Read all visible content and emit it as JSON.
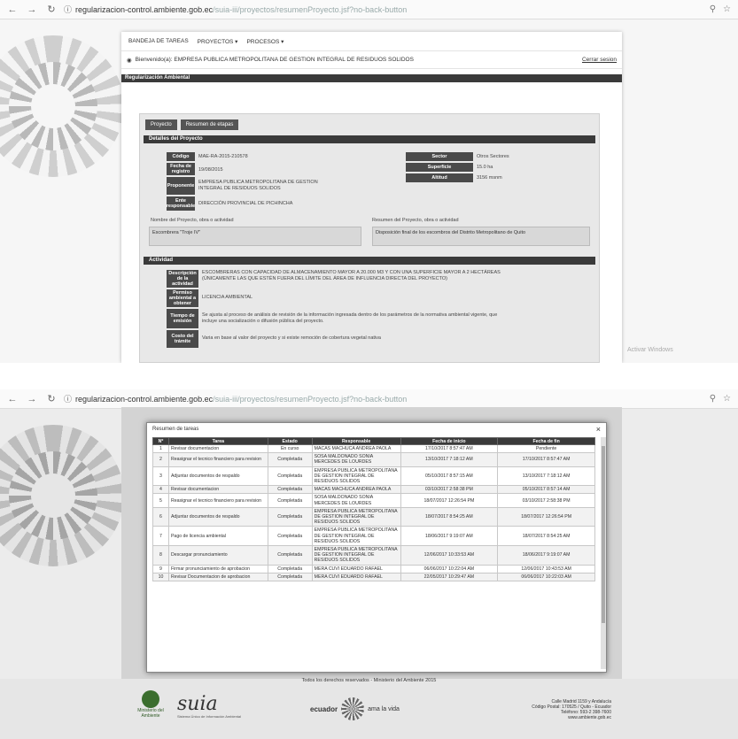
{
  "browser": {
    "url_host": "regularizacion-control.ambiente.gob.ec",
    "url_path": "/suia-iii/proyectos/resumenProyecto.jsf?no-back-button"
  },
  "screen1": {
    "menu": [
      "BANDEJA DE TAREAS",
      "PROYECTOS ▾",
      "PROCESOS ▾"
    ],
    "user_label": "Bienvenido(a): EMPRESA PUBLICA METROPOLITANA DE GESTION INTEGRAL DE RESIDUOS SOLIDOS",
    "logout": "Cerrar sesion",
    "section_title": "Regularización Ambiental",
    "tabs": [
      "Proyecto",
      "Resumen de etapas"
    ],
    "details_title": "Detalles del Proyecto",
    "fields": {
      "codigo_label": "Código",
      "codigo": "MAE-RA-2015-210578",
      "fecha_label": "Fecha de registro",
      "fecha": "19/08/2015",
      "proponente_label": "Proponente",
      "proponente": "EMPRESA PUBLICA METROPOLITANA DE GESTION INTEGRAL DE RESIDUOS SOLIDOS",
      "ente_label": "Ente responsable",
      "ente": "DIRECCIÓN PROVINCIAL DE PICHINCHA",
      "sector_label": "Sector",
      "sector": "Otros Sectores",
      "superficie_label": "Superficie",
      "superficie": "15.0 ha",
      "altitud_label": "Altitud",
      "altitud": "3156 msnm",
      "nombre_label": "Nombre del Proyecto, obra o actividad",
      "nombre": "Escombrera \"Troje IV\"",
      "resumen_label": "Resumen del Proyecto, obra o actividad",
      "resumen": "Disposición final de los escombros del Distrito Metropolitano de Quito"
    },
    "activity_title": "Actividad",
    "activity": {
      "descripcion_label": "Descripción de la actividad",
      "descripcion": "ESCOMBRERAS CON CAPACIDAD DE ALMACENAMIENTO MAYOR A 20.000 M3 Y CON UNA SUPERFICIE MAYOR A 2 HECTÁREAS (ÚNICAMENTE LAS QUE ESTÉN FUERA DEL LÍMITE DEL ÁREA DE INFLUENCIA DIRECTA DEL PROYECTO)",
      "permiso_label": "Permiso ambiental a obtener",
      "permiso": "LICENCIA AMBIENTAL",
      "tiempo_label": "Tiempo de emisión",
      "tiempo": "Se ajusta al proceso de análisis de revisión de la información ingresada dentro de los parámetros de la normativa ambiental vigente, que incluye una socialización o difusión pública del proyecto.",
      "costo_label": "Costo del trámite",
      "costo": "Varia en base al valor del proyecto y si existe remoción de cobertura vegetal nativa"
    },
    "watermark": "Activar Windows"
  },
  "screen2": {
    "modal_title": "Resumen de tareas",
    "close": "×",
    "columns": [
      "Nº",
      "Tarea",
      "Estado",
      "Responsable",
      "Fecha de inicio",
      "Fecha de fin"
    ],
    "rows": [
      [
        "1",
        "Revisar documentacion",
        "En curso",
        "MACAS MACHUCA ANDREA PAOLA",
        "17/10/2017 8:57:47 AM",
        "Pendiente"
      ],
      [
        "2",
        "Reasignar el tecnico financiero para revision",
        "Completada",
        "SOSA MALDONADO SONIA MERCEDES DE LOURDES",
        "13/10/2017 7:18:12 AM",
        "17/10/2017 8:57:47 AM"
      ],
      [
        "3",
        "Adjuntar documentos de respaldo",
        "Completada",
        "EMPRESA PUBLICA METROPOLITANA DE GESTION INTEGRAL DE RESIDUOS SOLIDOS",
        "05/10/2017 8:57:15 AM",
        "13/10/2017 7:18:12 AM"
      ],
      [
        "4",
        "Revisar documentacion",
        "Completada",
        "MACAS MACHUCA ANDREA PAOLA",
        "03/10/2017 2:58:38 PM",
        "05/10/2017 8:57:14 AM"
      ],
      [
        "5",
        "Reasignar el tecnico financiero para revision",
        "Completada",
        "SOSA MALDONADO SONIA MERCEDES DE LOURDES",
        "18/07/2017 12:26:54 PM",
        "03/10/2017 2:58:38 PM"
      ],
      [
        "6",
        "Adjuntar documentos de respaldo",
        "Completada",
        "EMPRESA PUBLICA METROPOLITANA DE GESTION INTEGRAL DE RESIDUOS SOLIDOS",
        "18/07/2017 8:54:25 AM",
        "18/07/2017 12:26:54 PM"
      ],
      [
        "7",
        "Pago de licencia ambiental",
        "Completada",
        "EMPRESA PUBLICA METROPOLITANA DE GESTION INTEGRAL DE RESIDUOS SOLIDOS",
        "18/06/2017 9:19:07 AM",
        "18/07/2017 8:54:25 AM"
      ],
      [
        "8",
        "Descargar pronunciamiento",
        "Completada",
        "EMPRESA PUBLICA METROPOLITANA DE GESTION INTEGRAL DE RESIDUOS SOLIDOS",
        "12/06/2017 10:33:53 AM",
        "18/06/2017 9:19:07 AM"
      ],
      [
        "9",
        "Firmar pronunciamiento de aprobacion",
        "Completada",
        "MERA CUVI EDUARDO RAFAEL",
        "06/06/2017 10:22:04 AM",
        "12/06/2017 10:43:53 AM"
      ],
      [
        "10",
        "Revisar Documentacion de aprobacion",
        "Completada",
        "MERA CUVI EDUARDO RAFAEL",
        "22/05/2017 10:29:47 AM",
        "06/06/2017 10:22:03 AM"
      ]
    ],
    "copyright": "Todos los derechos reservados - Ministerio del Ambiente 2015",
    "ministerio": "Ministerio del Ambiente",
    "suia": "suia",
    "suia_sub": "Sistema Único de Información Ambiental",
    "ecuador": "ecuador",
    "ecuador_tag": "ama la vida",
    "address_lines": [
      "Calle Madrid 1159 y Andalucía",
      "Código Postal: 170525 / Quito - Ecuador",
      "Teléfono: 593-2 398-7600",
      "www.ambiente.gob.ec"
    ]
  }
}
